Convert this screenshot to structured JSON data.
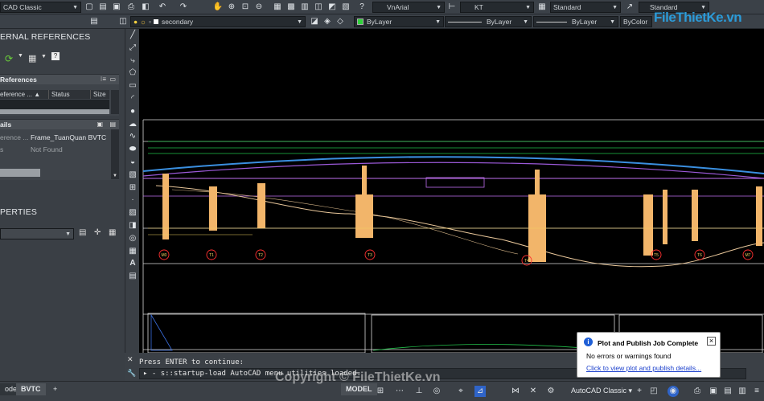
{
  "toolbar_top": {
    "workspace_combo": "CAD Classic",
    "text_style_combo": "VnArial",
    "dim_style_combo": "KT",
    "table_style_combo": "Standard",
    "multileader_style_combo": "Standard"
  },
  "toolbar_layer": {
    "layer_combo": "secondary",
    "color_combo": "ByLayer",
    "linetype_combo": "ByLayer",
    "lineweight_combo": "ByLayer",
    "plotstyle_combo": "ByColor"
  },
  "palette": {
    "title": "ERNAL REFERENCES",
    "references_title": "References",
    "columns": [
      "eference ...",
      "Status",
      "Size"
    ],
    "details_title": "ails",
    "details": [
      {
        "prop": "erence ...",
        "value": "Frame_TuanQuan BVTC"
      },
      {
        "prop": "s",
        "value": "Not Found"
      }
    ],
    "properties_title": "PERTIES"
  },
  "drawing": {
    "pier_labels": [
      "M0",
      "T1",
      "T2",
      "T3",
      "T4",
      "T5",
      "T6",
      "M7"
    ]
  },
  "command": {
    "history": "Press ENTER to continue:",
    "prompt_text": "s::startup-load AutoCAD menu utilities loaded."
  },
  "status": {
    "tabs": [
      "odel",
      "BVTC",
      "+"
    ],
    "model_button": "MODEL",
    "workspace": "AutoCAD Classic"
  },
  "balloon": {
    "title": "Plot and Publish Job Complete",
    "message": "No errors or warnings found",
    "link": "Click to view plot and publish details..."
  },
  "logo": "FileThietKe.vn",
  "watermark": "Copyright © FileThietKe.vn"
}
